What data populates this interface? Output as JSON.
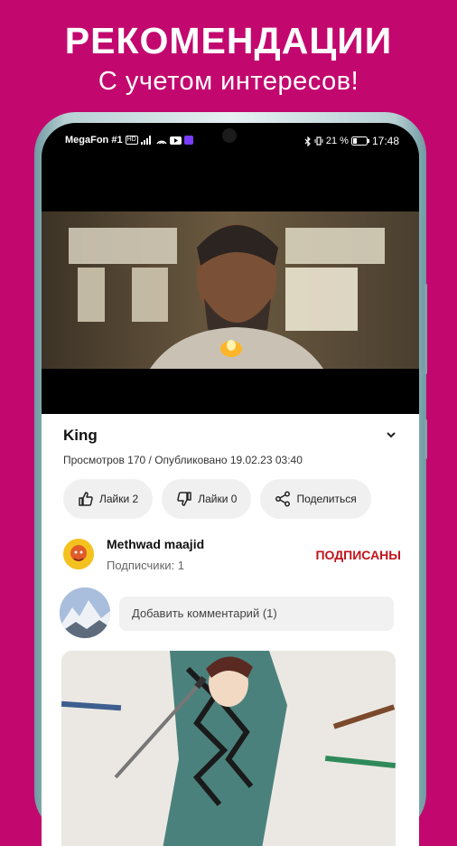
{
  "promo": {
    "headline": "РЕКОМЕНДАЦИИ",
    "subline": "С учетом интересов!"
  },
  "status_bar": {
    "carrier": "MegaFon #1",
    "battery": "21 %",
    "time": "17:48"
  },
  "video": {
    "title": "King",
    "meta": "Просмотров 170 / Опубликовано 19.02.23 03:40",
    "expand_icon": "chevron-down-icon"
  },
  "actions": {
    "like": "Лайки 2",
    "dislike": "Лайки 0",
    "share": "Поделиться"
  },
  "author": {
    "name": "Methwad maajid",
    "subscribers": "Подписчики: 1",
    "subscribe_state": "ПОДПИСАНЫ"
  },
  "comments": {
    "placeholder": "Добавить комментарий (1)"
  },
  "colors": {
    "background": "#c2086e",
    "subscribed": "#c1131a"
  }
}
